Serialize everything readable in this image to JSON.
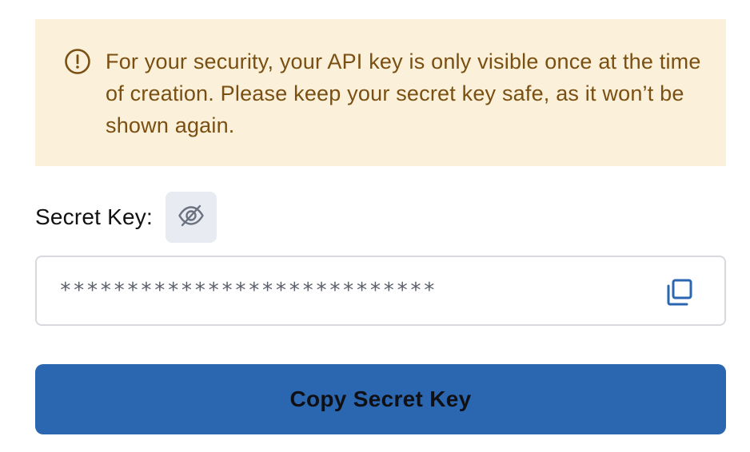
{
  "alert": {
    "icon": "exclamation-circle-icon",
    "message": "For your security, your API key is only visible once at the time of creation. Please keep your secret key safe, as it won’t be shown again.",
    "colors": {
      "background": "#fbf0d9",
      "text": "#7a4f12"
    }
  },
  "secret_key": {
    "label": "Secret Key:",
    "visibility_toggle_icon": "eye-off-icon",
    "masked_value": "****************************",
    "copy_icon": "copy-icon"
  },
  "copy_button": {
    "label": "Copy Secret Key",
    "color": "#2b67b0"
  }
}
